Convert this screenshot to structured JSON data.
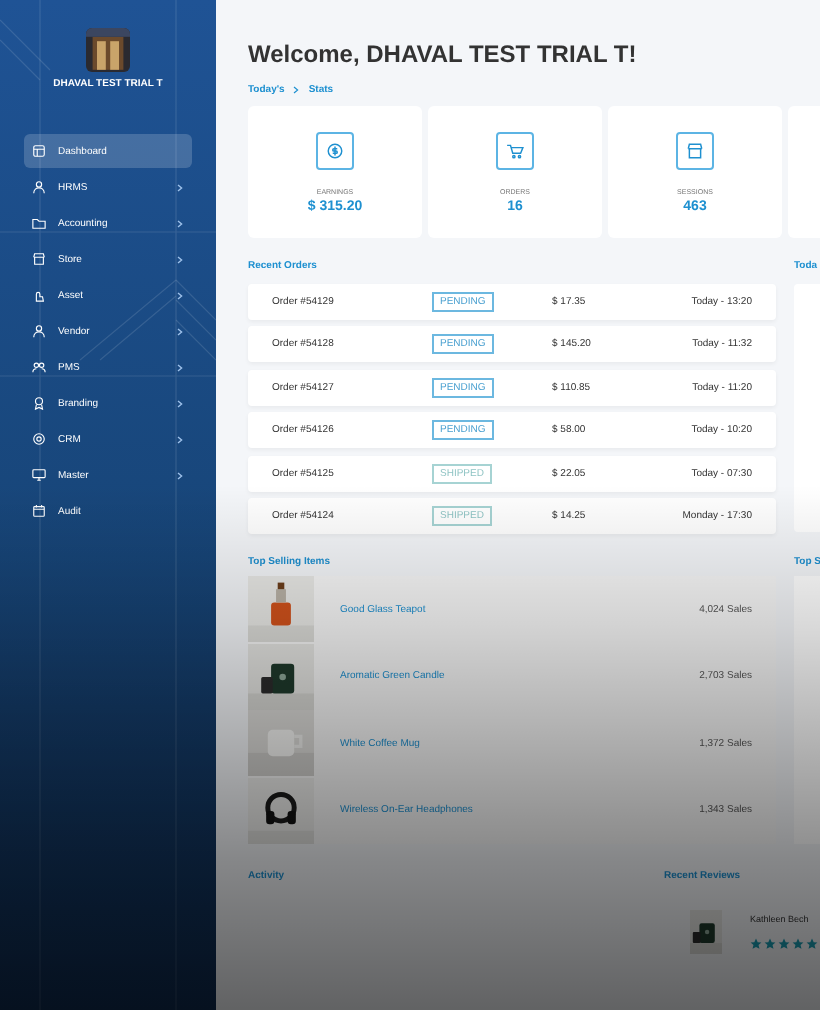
{
  "sidebar": {
    "user_name": "DHAVAL TEST TRIAL T",
    "items": [
      {
        "label": "Dashboard",
        "selected": true,
        "expandable": false
      },
      {
        "label": "HRMS",
        "selected": false,
        "expandable": true
      },
      {
        "label": "Accounting",
        "selected": false,
        "expandable": true
      },
      {
        "label": "Store",
        "selected": false,
        "expandable": true
      },
      {
        "label": "Asset",
        "selected": false,
        "expandable": true
      },
      {
        "label": "Vendor",
        "selected": false,
        "expandable": true
      },
      {
        "label": "PMS",
        "selected": false,
        "expandable": true
      },
      {
        "label": "Branding",
        "selected": false,
        "expandable": true
      },
      {
        "label": "CRM",
        "selected": false,
        "expandable": true
      },
      {
        "label": "Master",
        "selected": false,
        "expandable": true
      },
      {
        "label": "Audit",
        "selected": false,
        "expandable": false
      }
    ]
  },
  "header": {
    "title": "Welcome, DHAVAL TEST TRIAL T!",
    "breadcrumb": [
      "Today's",
      "Stats"
    ]
  },
  "stats": [
    {
      "label": "EARNINGS",
      "value": "$ 315.20"
    },
    {
      "label": "ORDERS",
      "value": "16"
    },
    {
      "label": "SESSIONS",
      "value": "463"
    }
  ],
  "recent_orders": {
    "title": "Recent Orders",
    "rows": [
      {
        "order": "Order #54129",
        "status": "PENDING",
        "kind": "pending",
        "amount": "$ 17.35",
        "time": "Today - 13:20"
      },
      {
        "order": "Order #54128",
        "status": "PENDING",
        "kind": "pending",
        "amount": "$ 145.20",
        "time": "Today - 11:32"
      },
      {
        "order": "Order #54127",
        "status": "PENDING",
        "kind": "pending",
        "amount": "$ 110.85",
        "time": "Today - 11:20"
      },
      {
        "order": "Order #54126",
        "status": "PENDING",
        "kind": "pending",
        "amount": "$ 58.00",
        "time": "Today - 10:20"
      },
      {
        "order": "Order #54125",
        "status": "SHIPPED",
        "kind": "shipped",
        "amount": "$ 22.05",
        "time": "Today - 07:30"
      },
      {
        "order": "Order #54124",
        "status": "SHIPPED",
        "kind": "shipped",
        "amount": "$ 14.25",
        "time": "Monday - 17:30"
      }
    ]
  },
  "side_panel": {
    "title": "Toda"
  },
  "top_selling": {
    "title": "Top Selling Items",
    "items": [
      {
        "name": "Good Glass Teapot",
        "sales": "4,024 Sales",
        "kind": "picture"
      },
      {
        "name": "Aromatic Green Candle",
        "sales": "2,703 Sales",
        "kind": "picture"
      },
      {
        "name": "White Coffee Mug",
        "sales": "1,372 Sales",
        "kind": "picture"
      },
      {
        "name": "Wireless On-Ear Headphones",
        "sales": "1,343 Sales",
        "kind": "picture"
      }
    ]
  },
  "side_panel_2": {
    "title": "Top S"
  },
  "activity": {
    "title": "Activity"
  },
  "recent_reviews": {
    "title": "Recent Reviews",
    "reviews": [
      {
        "name": "Kathleen Bech",
        "stars": 5
      }
    ]
  }
}
